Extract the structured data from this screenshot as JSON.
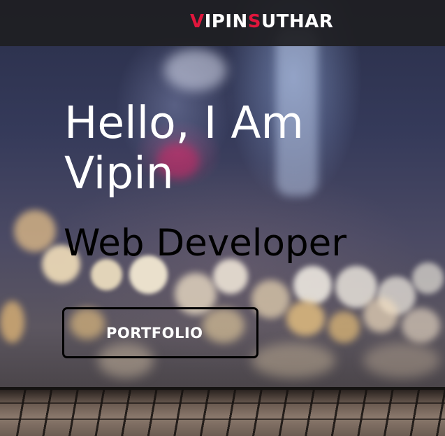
{
  "navbar": {
    "logo": {
      "part1_initial": "V",
      "part1_rest": "IPIN",
      "part2_initial": "S",
      "part2_rest": "UTHAR"
    }
  },
  "hero": {
    "greeting_line1": "Hello, I Am",
    "greeting_line2": "Vipin",
    "role": "Web Developer",
    "portfolio_button_label": "PORTFOLIO"
  },
  "colors": {
    "accent": "#e0163c",
    "navbar_bg": "#1e1e22",
    "headline_text": "#ffffff",
    "role_text": "#000000"
  }
}
